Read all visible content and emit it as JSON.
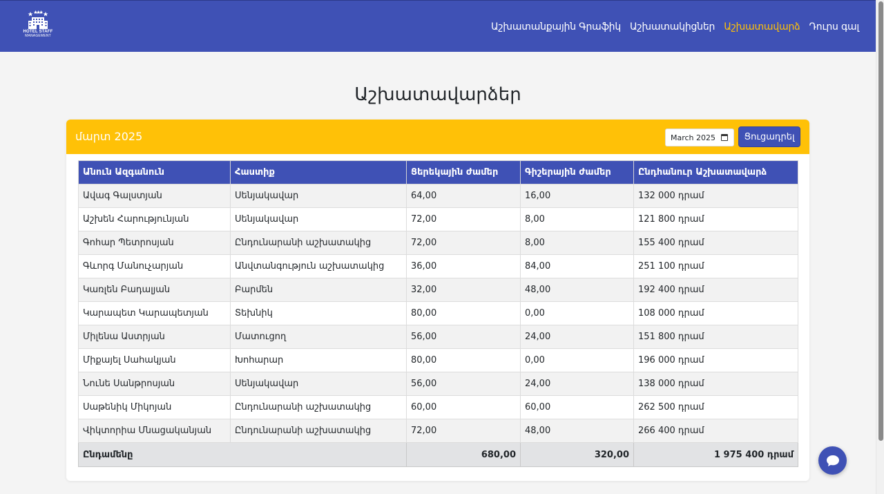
{
  "brand": {
    "logo_line1": "HOTEL STAFF",
    "logo_line2": "MANAGEMENT"
  },
  "nav": {
    "items": [
      {
        "label": "Աշխատանքային Գրաֆիկ",
        "active": false
      },
      {
        "label": "Աշխատակիցներ",
        "active": false
      },
      {
        "label": "Աշխատավարձ",
        "active": true
      },
      {
        "label": "Դուրս գալ",
        "active": false
      }
    ]
  },
  "page": {
    "title": "Աշխատավարձեր"
  },
  "card": {
    "period_label": "մարտ 2025",
    "month_input_value": "March 2025",
    "show_button": "Ցուցադրել"
  },
  "table": {
    "headers": [
      "Անուն Ազգանուն",
      "Հաստիք",
      "Ցերեկային ժամեր",
      "Գիշերային ժամեր",
      "Ընդհանուր Աշխատավարձ"
    ],
    "rows": [
      [
        "Ավագ Գալստյան",
        "Սենյակավար",
        "64,00",
        "16,00",
        "132 000 դրամ"
      ],
      [
        "Աշխեն Հարությունյան",
        "Սենյակավար",
        "72,00",
        "8,00",
        "121 800 դրամ"
      ],
      [
        "Գոհար Պետրոսյան",
        "Ընդունարանի աշխատակից",
        "72,00",
        "8,00",
        "155 400 դրամ"
      ],
      [
        "Գևորգ Մանուչարյան",
        "Անվտանգություն աշխատակից",
        "36,00",
        "84,00",
        "251 100 դրամ"
      ],
      [
        "Կառլեն Բադալյան",
        "Բարմեն",
        "32,00",
        "48,00",
        "192 400 դրամ"
      ],
      [
        "Կարապետ Կարապետյան",
        "Տեխնիկ",
        "80,00",
        "0,00",
        "108 000 դրամ"
      ],
      [
        "Միլենա Աստրյան",
        "Մատուցող",
        "56,00",
        "24,00",
        "151 800 դրամ"
      ],
      [
        "Միքայել Սահակյան",
        "Խոհարար",
        "80,00",
        "0,00",
        "196 000 դրամ"
      ],
      [
        "Նունե Սանթրոսյան",
        "Սենյակավար",
        "56,00",
        "24,00",
        "138 000 դրամ"
      ],
      [
        "Սաթենիկ Միկոյան",
        "Ընդունարանի աշխատակից",
        "60,00",
        "60,00",
        "262 500 դրամ"
      ],
      [
        "Վիկտորիա Մնացականյան",
        "Ընդունարանի աշխատակից",
        "72,00",
        "48,00",
        "266 400 դրամ"
      ]
    ],
    "footer": {
      "label": "Ընդամենը",
      "day_hours": "680,00",
      "night_hours": "320,00",
      "total": "1 975 400 դրամ"
    }
  },
  "colors": {
    "primary": "#3f51b5",
    "accent": "#ffc107"
  }
}
